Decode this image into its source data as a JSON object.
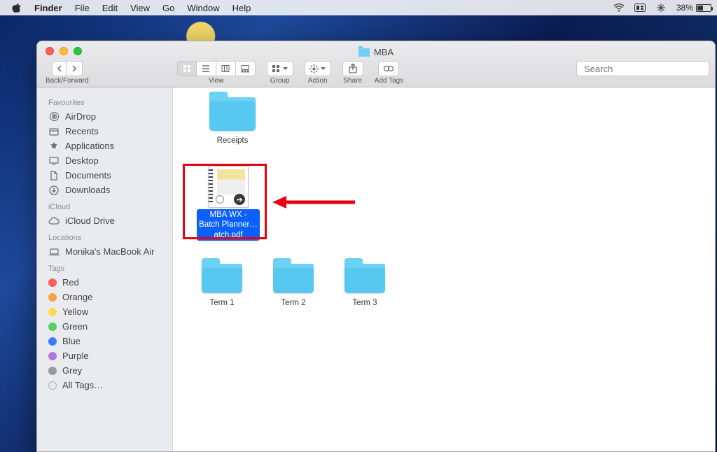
{
  "menubar": {
    "app": "Finder",
    "items": [
      "File",
      "Edit",
      "View",
      "Go",
      "Window",
      "Help"
    ],
    "status": {
      "battery_pct": "38%"
    }
  },
  "window": {
    "title": "MBA",
    "nav_label": "Back/Forward",
    "view_label": "View",
    "group_label": "Group",
    "action_label": "Action",
    "share_label": "Share",
    "tags_label": "Add Tags",
    "search_placeholder": "Search"
  },
  "sidebar": {
    "sections": [
      {
        "name": "Favourites",
        "items": [
          {
            "icon": "airdrop",
            "label": "AirDrop"
          },
          {
            "icon": "recents",
            "label": "Recents"
          },
          {
            "icon": "apps",
            "label": "Applications"
          },
          {
            "icon": "desktop",
            "label": "Desktop"
          },
          {
            "icon": "documents",
            "label": "Documents"
          },
          {
            "icon": "downloads",
            "label": "Downloads"
          }
        ]
      },
      {
        "name": "iCloud",
        "items": [
          {
            "icon": "cloud",
            "label": "iCloud Drive"
          }
        ]
      },
      {
        "name": "Locations",
        "items": [
          {
            "icon": "laptop",
            "label": "Monika's MacBook Air"
          }
        ]
      },
      {
        "name": "Tags",
        "items": [
          {
            "color": "#ff5b56",
            "label": "Red"
          },
          {
            "color": "#ff9f3e",
            "label": "Orange"
          },
          {
            "color": "#ffd84c",
            "label": "Yellow"
          },
          {
            "color": "#52d164",
            "label": "Green"
          },
          {
            "color": "#3f7bff",
            "label": "Blue"
          },
          {
            "color": "#b575e1",
            "label": "Purple"
          },
          {
            "color": "#9a9a9d",
            "label": "Grey"
          },
          {
            "color": "none",
            "label": "All Tags…"
          }
        ]
      }
    ]
  },
  "content": {
    "items": [
      {
        "type": "folder",
        "label": "Receipts"
      },
      {
        "type": "pdf",
        "label": "MBA WX - Batch Planner…atch.pdf",
        "selected": true
      },
      {
        "type": "folder",
        "label": "Term 1"
      },
      {
        "type": "folder",
        "label": "Term 2"
      },
      {
        "type": "folder",
        "label": "Term 3"
      }
    ]
  }
}
